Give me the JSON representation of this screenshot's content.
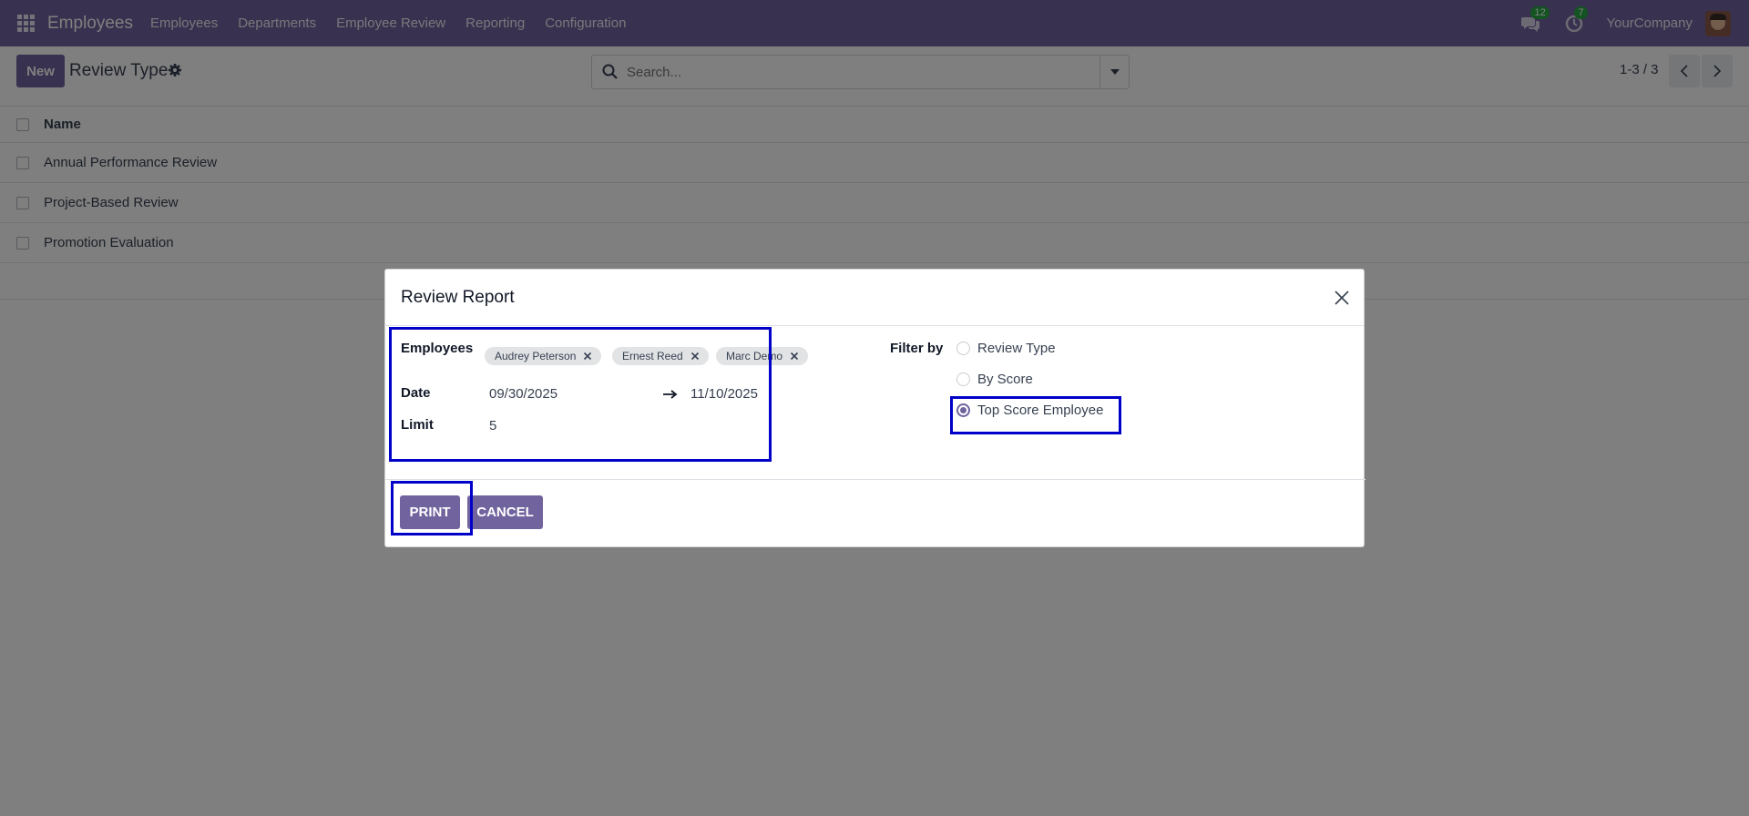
{
  "navbar": {
    "app_name": "Employees",
    "menu": [
      "Employees",
      "Departments",
      "Employee Review",
      "Reporting",
      "Configuration"
    ],
    "messages_count": "12",
    "activities_count": "7",
    "company": "YourCompany"
  },
  "control_panel": {
    "new_label": "New",
    "title": "Review Type",
    "search_placeholder": "Search...",
    "pager": "1-3 / 3"
  },
  "list": {
    "header": "Name",
    "rows": [
      "Annual Performance Review",
      "Project-Based Review",
      "Promotion Evaluation"
    ]
  },
  "modal": {
    "title": "Review Report",
    "employees_label": "Employees",
    "employees": [
      "Audrey Peterson",
      "Ernest Reed",
      "Marc Demo"
    ],
    "date_label": "Date",
    "date_from": "09/30/2025",
    "date_to": "11/10/2025",
    "limit_label": "Limit",
    "limit_value": "5",
    "filter_label": "Filter by",
    "filter_options": [
      "Review Type",
      "By Score",
      "Top Score Employee"
    ],
    "filter_selected": "Top Score Employee",
    "print_label": "PRINT",
    "cancel_label": "CANCEL"
  },
  "colors": {
    "brand": "#71639e",
    "highlight": "#0000c8",
    "badge": "#28a745"
  }
}
